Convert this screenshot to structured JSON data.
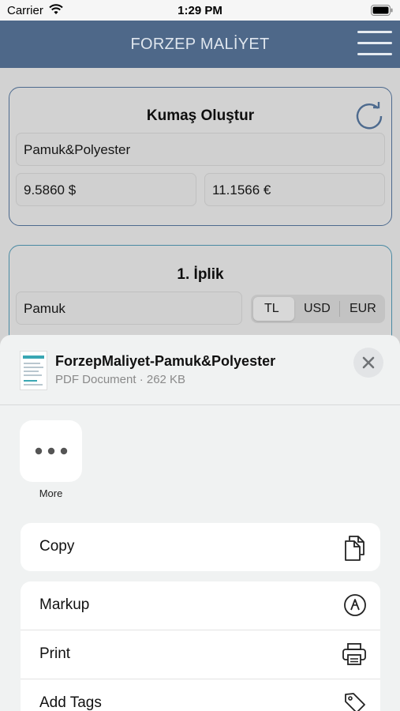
{
  "status_bar": {
    "carrier": "Carrier",
    "time": "1:29 PM"
  },
  "navbar": {
    "title": "FORZEP MALİYET"
  },
  "fabric_card": {
    "title": "Kumaş Oluştur",
    "name_value": "Pamuk&Polyester",
    "usd_value": "9.5860 $",
    "eur_value": "11.1566 €"
  },
  "yarn_card": {
    "title": "1. İplik",
    "name_value": "Pamuk",
    "currency_options": [
      "TL",
      "USD",
      "EUR"
    ],
    "selected_currency": "TL"
  },
  "share_sheet": {
    "file_name": "ForzepMaliyet-Pamuk&Polyester",
    "file_meta": "PDF Document · 262 KB",
    "more_label": "More",
    "actions": [
      {
        "label": "Copy",
        "icon": "copy-icon"
      },
      {
        "label": "Markup",
        "icon": "markup-icon"
      },
      {
        "label": "Print",
        "icon": "print-icon"
      },
      {
        "label": "Add Tags",
        "icon": "tag-icon"
      }
    ]
  },
  "colors": {
    "navbar": "#4e6889",
    "card_border": "#4d6a8e",
    "sheet_bg": "#f0f2f2"
  }
}
